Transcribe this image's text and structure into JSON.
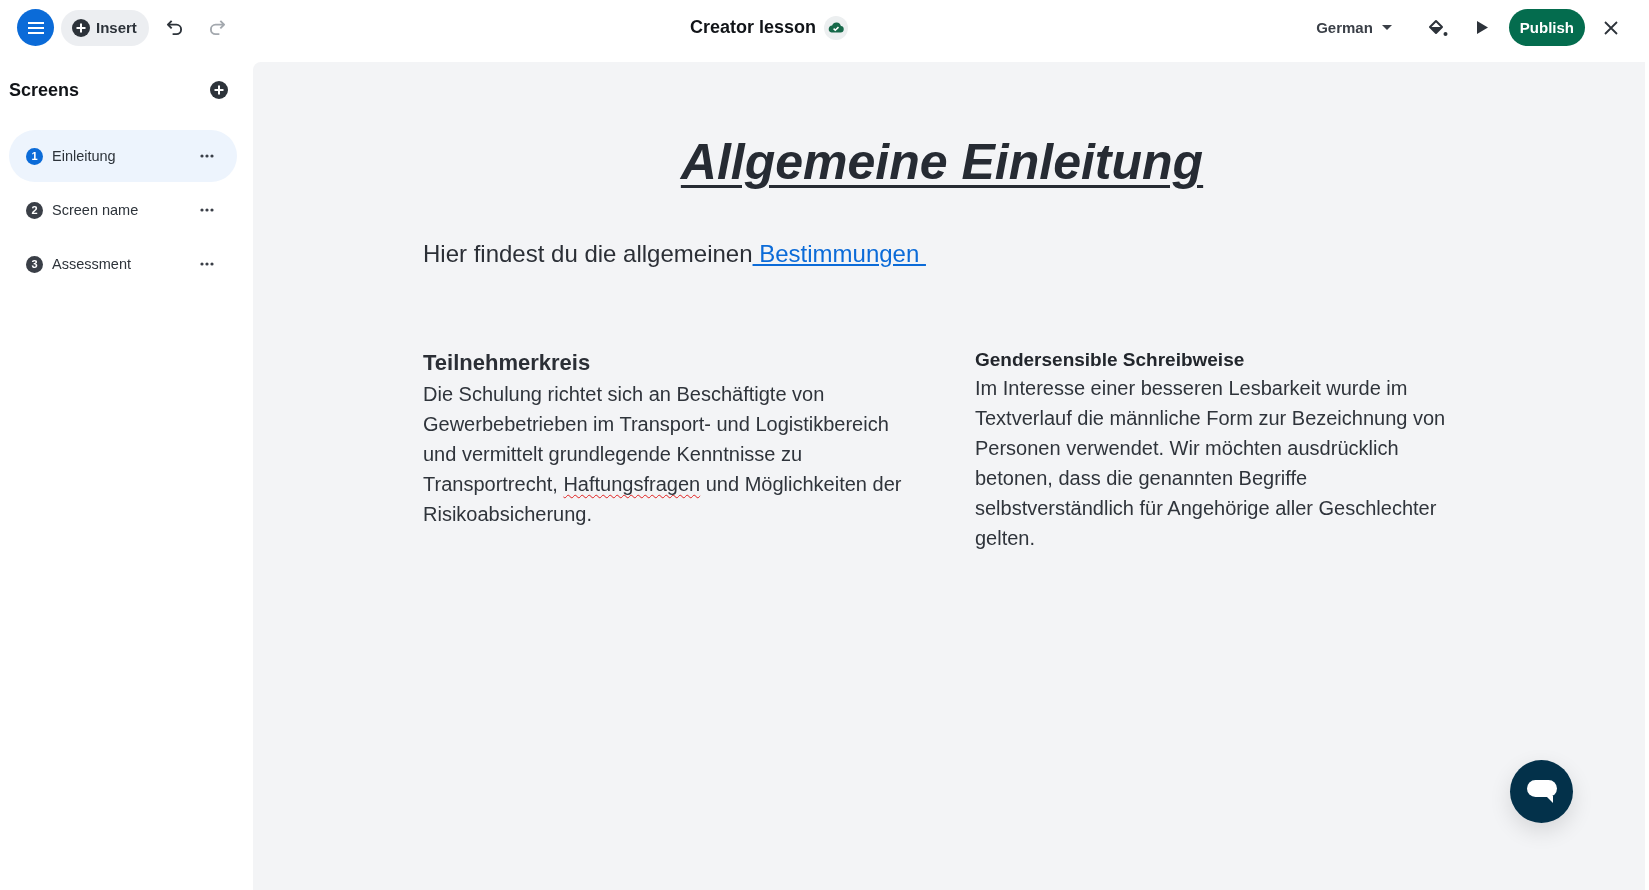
{
  "toolbar": {
    "insert_button": {
      "label": "Insert"
    },
    "undo": {
      "disabled": false
    },
    "redo": {
      "disabled": true
    },
    "document": {
      "title": "Creator lesson",
      "saved": true
    },
    "language": {
      "label": "German"
    },
    "publish_button": {
      "label": "Publish"
    }
  },
  "sidebar": {
    "title": "Screens",
    "screens": [
      {
        "number": "1",
        "name": "Einleitung",
        "selected": true
      },
      {
        "number": "2",
        "name": "Screen name",
        "selected": false
      },
      {
        "number": "3",
        "name": "Assessment",
        "selected": false
      }
    ]
  },
  "canvas": {
    "title": "Allgemeine Einleitung",
    "intro": {
      "text": "Hier findest du die allgemeinen",
      "link": " Bestimmungen "
    },
    "columns": [
      {
        "kind": "heading",
        "title": "Teilnehmerkreis",
        "body": [
          {
            "text": "Die Schulung richtet sich an Beschäftigte von Gewerbebetrieben im Transport- und Logistikbereich und vermittelt grundlegende Kenntnisse zu Transportrecht, ",
            "misspelled": false
          },
          {
            "text": "Haftungsfragen",
            "misspelled": true
          },
          {
            "text": " und Möglichkeiten der Risikoabsicherung.",
            "misspelled": false
          }
        ]
      },
      {
        "kind": "label",
        "title": "Gendersensible Schreibweise",
        "body": [
          {
            "text": "Im Interesse einer besseren Lesbarkeit wurde im Textverlauf die männliche Form zur Bezeichnung von Personen verwendet. Wir möchten ausdrücklich betonen, dass die genannten Begriffe selbstverständlich für Angehörige aller Geschlechter gelten.",
            "misspelled": false
          }
        ]
      }
    ]
  }
}
